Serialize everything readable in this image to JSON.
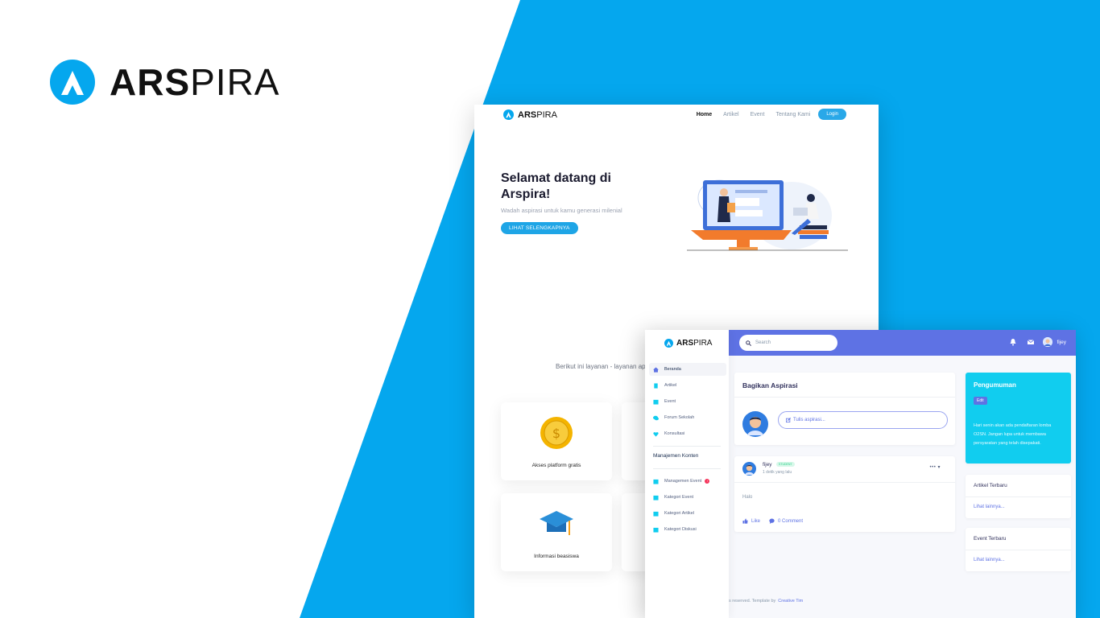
{
  "colors": {
    "accent_blue": "#05a7ee",
    "dashboard_primary": "#5e72e4",
    "announcement_cyan": "#11cdef"
  },
  "brand": {
    "bold": "ARS",
    "light": "PIRA",
    "logo_icon": "arspira-logo-icon"
  },
  "landing": {
    "nav": {
      "brand_bold": "ARS",
      "brand_light": "PIRA",
      "links": [
        "Home",
        "Artikel",
        "Event",
        "Tentang Kami"
      ],
      "login": "Login"
    },
    "hero": {
      "title": "Selamat datang di Arspira!",
      "subtitle": "Wadah aspirasi untuk kamu generasi milenial",
      "button": "LIHAT SELENGKAPNYA"
    },
    "services_intro": "Berikut ini layanan - layanan apa s",
    "cards": [
      {
        "label": "Akses platform gratis",
        "icon": "dollar-coin-icon"
      },
      {
        "label": "Informasi beasiswa",
        "icon": "graduation-cap-icon"
      }
    ]
  },
  "dashboard": {
    "brand_bold": "ARS",
    "brand_light": "PIRA",
    "search_placeholder": "Search",
    "user_name": "fijey",
    "sidebar": {
      "items": [
        "Beranda",
        "Artikel",
        "Event",
        "Forum Sekolah",
        "Konsultasi"
      ],
      "section_title": "Manajemen Konten",
      "manage_items": [
        "Managemen Event",
        "Kategori Event",
        "Kategori Artikel",
        "Kategori Diskusi"
      ]
    },
    "share": {
      "title": "Bagikan Aspirasi",
      "button": "Tulis aspirasi..."
    },
    "post": {
      "author": "fijey",
      "badge": "STUDENT",
      "time": "1 detik yang lalu",
      "more": "•••",
      "content": "Halo",
      "like": "Like",
      "comment": "0 Comment"
    },
    "announcement": {
      "title": "Pengumuman",
      "edit": "Edit",
      "body": "Hari senin akan ada pendaftaran lomba O2SN. Jangan lupa untuk membawa persyaratan yang telah disepakati."
    },
    "latest_articles": {
      "title": "Artikel Terbaru",
      "link": "Lihat lainnya..."
    },
    "latest_events": {
      "title": "Event Terbaru",
      "link": "Lihat lainnya..."
    },
    "footer": {
      "text": "s reserved. Template by",
      "credit": "Creative Tim"
    }
  }
}
